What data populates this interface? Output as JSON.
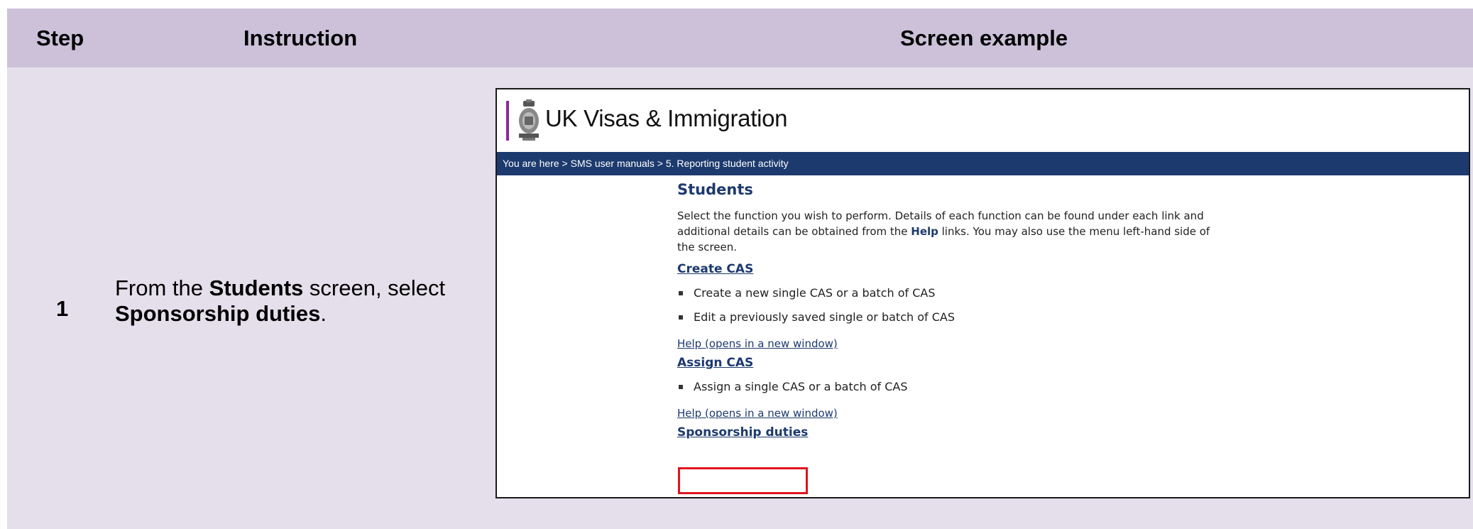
{
  "table": {
    "headers": {
      "step": "Step",
      "instruction": "Instruction",
      "screen": "Screen example"
    },
    "row": {
      "step": "1",
      "instruction": {
        "part1": "From the ",
        "bold1": "Students",
        "part2": " screen, select ",
        "bold2": "Sponsorship duties",
        "part3": "."
      }
    }
  },
  "screenshot": {
    "brand": "UK Visas & Immigration",
    "breadcrumb": "You are here > SMS user manuals > 5. Reporting student activity",
    "title": "Students",
    "intro": {
      "text1": "Select the function you wish to perform. Details of each function can be found under each link and additional details can be obtained from the ",
      "bold": "Help",
      "text2": " links. You may also use the menu left-hand side of the screen."
    },
    "sections": [
      {
        "link": "Create CAS",
        "items": [
          "Create a new single CAS or a batch of CAS",
          "Edit a previously saved single or batch of CAS"
        ],
        "help": "Help (opens in a new window)"
      },
      {
        "link": "Assign CAS",
        "items": [
          "Assign a single CAS or a batch of CAS"
        ],
        "help": "Help (opens in a new window)"
      },
      {
        "link": "Sponsorship duties"
      }
    ]
  },
  "colors": {
    "header_bg": "#ccc1d9",
    "row_bg": "#e5dfeb",
    "nav_blue": "#1d3a6e",
    "highlight": "#e0141d",
    "brand_bar": "#8b2a9c"
  }
}
